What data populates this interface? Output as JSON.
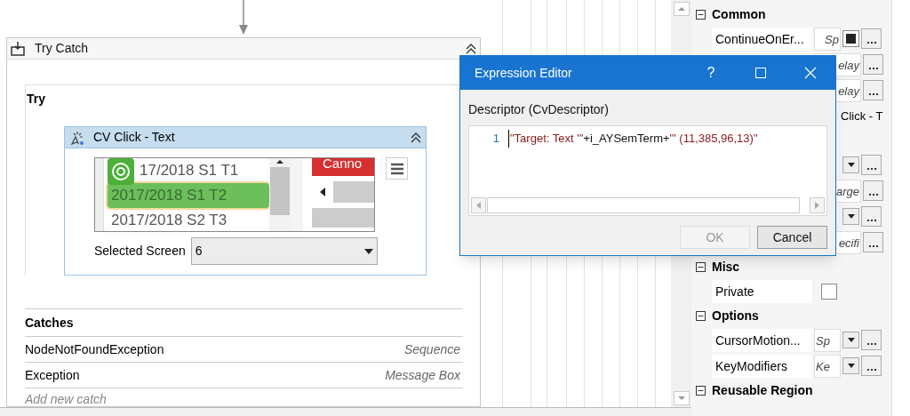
{
  "designer": {
    "try_catch": {
      "title": "Try Catch",
      "expanded": true,
      "try": {
        "label": "Try",
        "activity": {
          "title": "CV Click - Text",
          "expanded": true,
          "screenshot": {
            "items": [
              {
                "label": "17/2018 S1 T1",
                "selected": false
              },
              {
                "label": "2017/2018 S1 T2",
                "selected": true
              },
              {
                "label": "2017/2018 S2 T3",
                "selected": false
              }
            ],
            "button": "Canno"
          },
          "selected_screen": {
            "label": "Selected Screen",
            "value": "6"
          }
        }
      },
      "catches": {
        "label": "Catches",
        "rows": [
          {
            "exception": "NodeNotFoundException",
            "handler": "Sequence"
          },
          {
            "exception": "Exception",
            "handler": "Message Box"
          }
        ],
        "add_label": "Add new catch"
      }
    }
  },
  "properties": {
    "categories": [
      {
        "name": "Common",
        "expanded": true,
        "rows": [
          {
            "kind": "checkexpr",
            "name": "ContinueOnEr...",
            "value": "Sp",
            "checked": true
          },
          {
            "kind": "plain",
            "value": "elay"
          },
          {
            "kind": "plain",
            "value": "elay"
          },
          {
            "kind": "wide",
            "value": "Click - T"
          }
        ]
      },
      {
        "rows": [
          {
            "kind": "dropdown"
          },
          {
            "kind": "plain",
            "value": "arge"
          },
          {
            "kind": "dropdown"
          },
          {
            "kind": "plain",
            "value": "ecifi"
          }
        ]
      },
      {
        "name": "Misc",
        "expanded": true,
        "rows": [
          {
            "kind": "check",
            "name": "Private",
            "checked": false
          }
        ]
      },
      {
        "name": "Options",
        "expanded": true,
        "rows": [
          {
            "kind": "dropdown",
            "name": "CursorMotion...",
            "value": "Sp"
          },
          {
            "kind": "dropdown",
            "name": "KeyModifiers",
            "value": "Ke"
          }
        ]
      },
      {
        "name": "Reusable Region",
        "expanded": true
      }
    ]
  },
  "dialog": {
    "title": "Expression Editor",
    "help": "?",
    "field_label": "Descriptor (CvDescriptor)",
    "editor": {
      "line_number": "1",
      "tokens": [
        {
          "kind": "string",
          "text": "\"Target: Text '\""
        },
        {
          "kind": "code",
          "text": "+i_AYSemTerm+"
        },
        {
          "kind": "string",
          "text": "\"' (11,385,96,13)\""
        }
      ]
    },
    "buttons": [
      {
        "label": "OK",
        "disabled": true
      },
      {
        "label": "Cancel",
        "disabled": false
      }
    ]
  }
}
